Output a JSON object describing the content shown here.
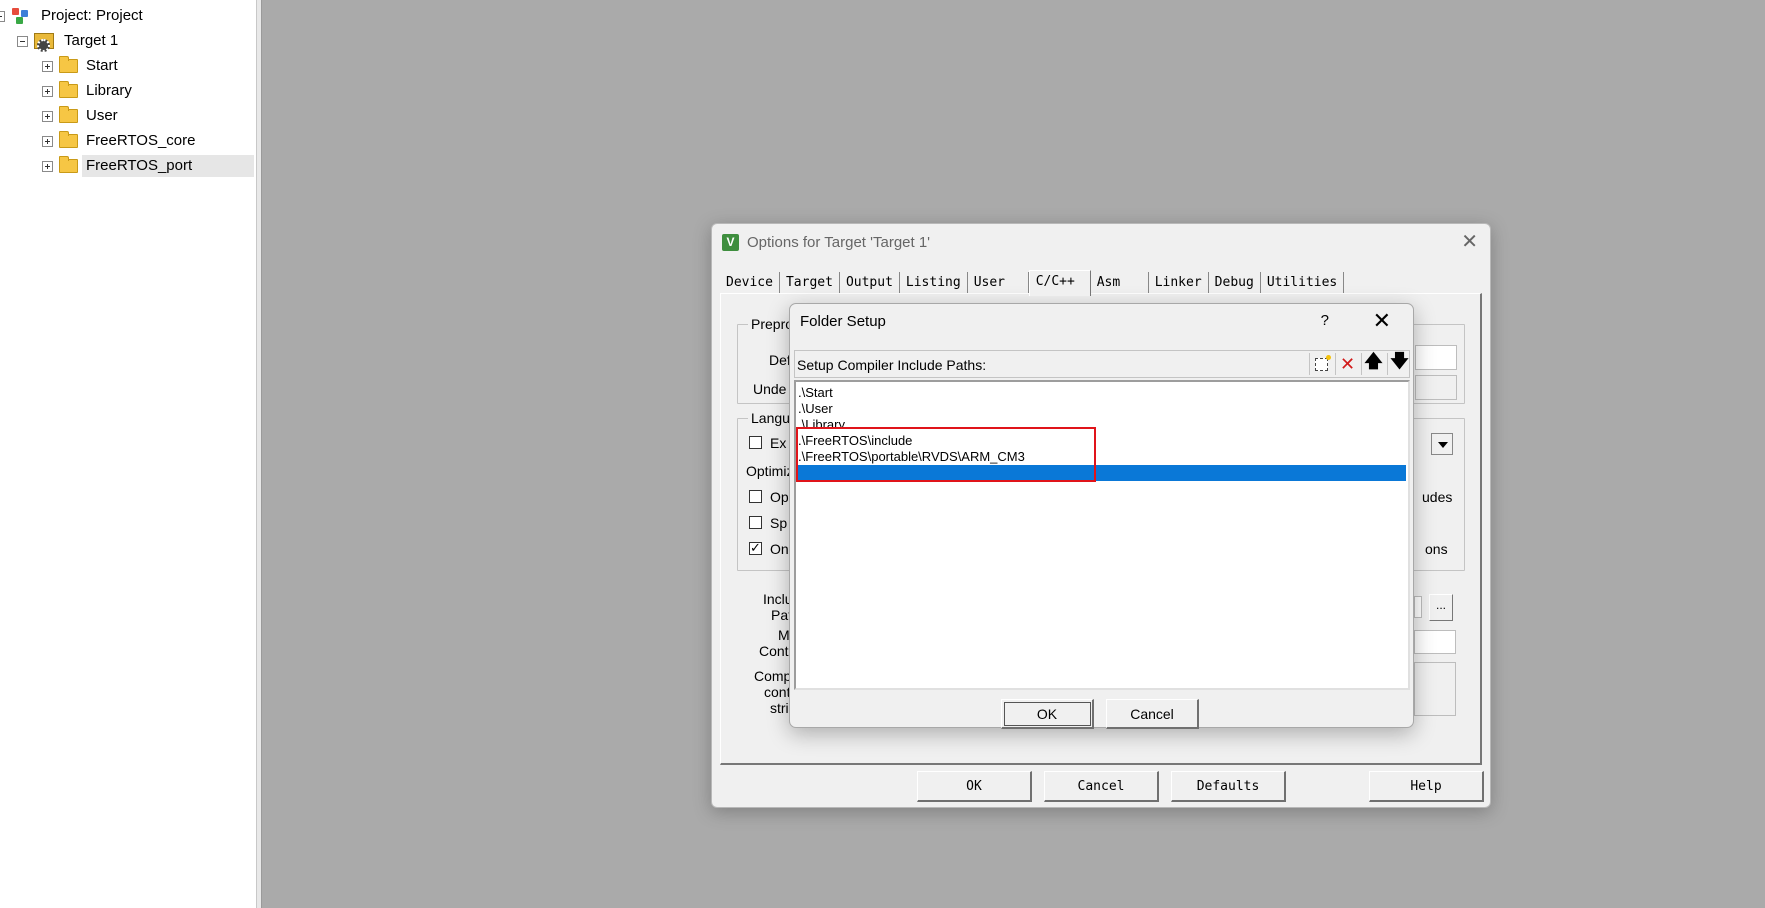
{
  "project_tree": {
    "root": "Project: Project",
    "target": "Target 1",
    "groups": [
      "Start",
      "Library",
      "User",
      "FreeRTOS_core",
      "FreeRTOS_port"
    ],
    "selected_group": "FreeRTOS_port"
  },
  "options_dialog": {
    "title": "Options for Target 'Target 1'",
    "app_icon_glyph": "V",
    "close_glyph": "✕",
    "tabs": [
      "Device",
      "Target",
      "Output",
      "Listing",
      "User",
      "C/C++",
      "Asm",
      "Linker",
      "Debug",
      "Utilities"
    ],
    "active_tab": "C/C++",
    "fragments": {
      "preproc_group": "Preproc",
      "def": "Def",
      "undef": "Unde",
      "language_group": "Langu",
      "ex": "Ex",
      "optimiz": "Optimiz",
      "op": "Op",
      "sp": "Sp",
      "on": "On",
      "udes": "udes",
      "ons": "ons",
      "inclu": "Inclu",
      "pat": "Pat",
      "m": "M",
      "contr": "Contr",
      "comp": "Comp",
      "cont": "cont",
      "stri": "stri",
      "browse": "..."
    },
    "buttons": {
      "ok": "OK",
      "cancel": "Cancel",
      "defaults": "Defaults",
      "help": "Help"
    }
  },
  "folder_setup": {
    "title": "Folder Setup",
    "help_glyph": "?",
    "close_glyph": "✕",
    "header_label": "Setup Compiler Include Paths:",
    "toolbar": {
      "delete_glyph": "✕",
      "up_glyph": "🡅",
      "down_glyph": "🡇"
    },
    "paths": [
      ".\\Start",
      ".\\User",
      ".\\Library",
      ".\\FreeRTOS\\include",
      ".\\FreeRTOS\\portable\\RVDS\\ARM_CM3",
      ""
    ],
    "selected_index": 5,
    "highlight_color": "#e0141a",
    "selection_color": "#0a78d7",
    "buttons": {
      "ok": "OK",
      "cancel": "Cancel"
    }
  }
}
